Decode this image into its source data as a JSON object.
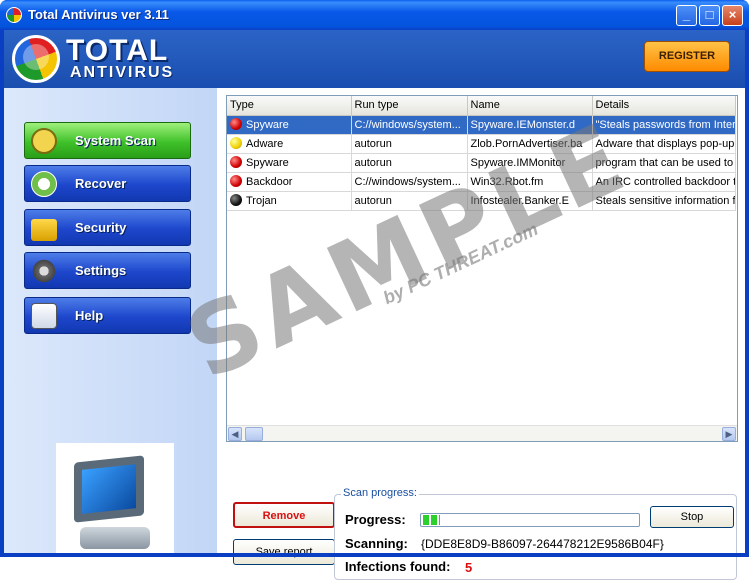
{
  "window": {
    "title": "Total Antivirus ver 3.11",
    "controls": {
      "minimize": "_",
      "maximize": "□",
      "close": "×"
    }
  },
  "header": {
    "logo_line1": "TOTAL",
    "logo_line2": "ANTIVIRUS",
    "register_label": "REGISTER"
  },
  "sidebar": {
    "items": [
      {
        "label": "System Scan",
        "icon": "magnifier-icon",
        "active": true
      },
      {
        "label": "Recover",
        "icon": "recover-clock-icon",
        "active": false
      },
      {
        "label": "Security",
        "icon": "padlock-icon",
        "active": false
      },
      {
        "label": "Settings",
        "icon": "gear-icon",
        "active": false
      },
      {
        "label": "Help",
        "icon": "help-document-icon",
        "active": false
      }
    ]
  },
  "results": {
    "columns": [
      "Type",
      "Run type",
      "Name",
      "Details"
    ],
    "rows": [
      {
        "severity": "red",
        "type": "Spyware",
        "run_type": "C://windows/system...",
        "name": "Spyware.IEMonster.d",
        "details": "\"Steals passwords from Inter",
        "selected": true
      },
      {
        "severity": "yellow",
        "type": "Adware",
        "run_type": "autorun",
        "name": "Zlob.PornAdvertiser.ba",
        "details": "Adware that displays pop-up",
        "selected": false
      },
      {
        "severity": "red",
        "type": "Spyware",
        "run_type": "autorun",
        "name": "Spyware.IMMonitor",
        "details": "program that can be used to",
        "selected": false
      },
      {
        "severity": "red",
        "type": "Backdoor",
        "run_type": "C://windows/system...",
        "name": "Win32.Rbot.fm",
        "details": "An IRC controlled backdoor th",
        "selected": false
      },
      {
        "severity": "black",
        "type": "Trojan",
        "run_type": "autorun",
        "name": "Infostealer.Banker.E",
        "details": "Steals sensitive information fr",
        "selected": false
      }
    ]
  },
  "actions": {
    "remove_label": "Remove",
    "save_report_label": "Save report"
  },
  "scan_progress": {
    "group_title": "Scan progress:",
    "progress_label": "Progress:",
    "progress_fraction": 0.08,
    "stop_label": "Stop",
    "scanning_label": "Scanning:",
    "scanning_value": "{DDE8E8D9-B86097-264478212E9586B04F}",
    "infections_label": "Infections found:",
    "infections_count": "5"
  },
  "watermark": {
    "main": "SAMPLE",
    "sub": "by PC THREAT.com"
  },
  "colors": {
    "title_bar": "#0454dd",
    "header_bg": "#2b64c6",
    "register_orange": "#ff8a00",
    "nav_blue": "#1d46cc",
    "nav_green": "#3fc12a",
    "selection_blue": "#316ac5",
    "danger_red": "#d81010"
  }
}
